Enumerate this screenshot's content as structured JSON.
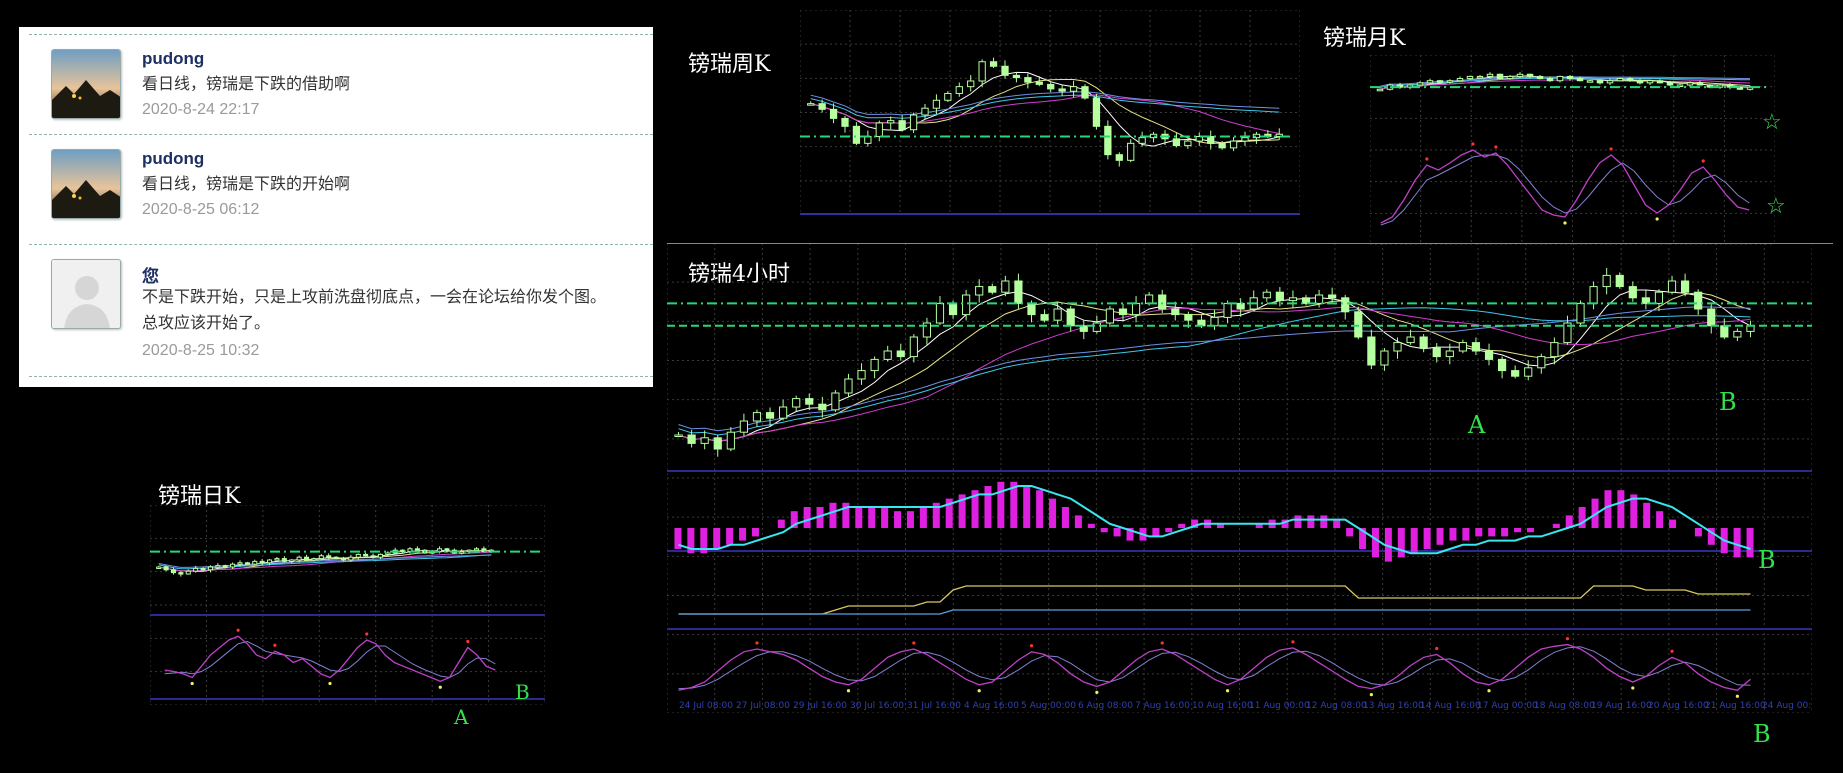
{
  "comments": [
    {
      "user": "pudong",
      "text": "看日线，镑瑞是下跌的借助啊",
      "time": "2020-8-24 22:17",
      "avatar": "landscape"
    },
    {
      "user": "pudong",
      "text": "看日线，镑瑞是下跌的开始啊",
      "time": "2020-8-25 06:12",
      "avatar": "landscape"
    },
    {
      "user": "您",
      "text": "不是下跌开始，只是上攻前洗盘彻底点，一会在论坛给你发个图。",
      "text2": "总攻应该开始了。",
      "time": "2020-8-25 10:32",
      "avatar": "default-user"
    }
  ],
  "colors": {
    "bull": "#b6ff9e",
    "bear": "#b6ff9e",
    "ma_fast": "#ffffff",
    "ma_yellow": "#e8e38a",
    "ma_magenta": "#d23bd2",
    "ma_cyan": "#3ec7e8",
    "ma_blue": "#6f8fe6",
    "level": "#25d97a",
    "macd_hist": "#e020e0",
    "macd_line": "#38e6f0",
    "stoch_k": "#c040c8",
    "stoch_d": "#8080d0",
    "marker": "#33e24a",
    "grid": "#3a3a3a"
  },
  "chart_data": [
    {
      "id": "weekly",
      "type": "candlestick",
      "title": "镑瑞周K",
      "close": [
        1.225,
        1.22,
        1.212,
        1.205,
        1.19,
        1.196,
        1.208,
        1.21,
        1.202,
        1.215,
        1.221,
        1.228,
        1.234,
        1.24,
        1.245,
        1.262,
        1.258,
        1.25,
        1.248,
        1.244,
        1.242,
        1.238,
        1.236,
        1.24,
        1.23,
        1.205,
        1.18,
        1.175,
        1.19,
        1.195,
        1.198,
        1.194,
        1.188,
        1.192,
        1.196,
        1.19,
        1.186,
        1.192,
        1.195,
        1.198,
        1.196,
        1.198
      ],
      "level": 1.196,
      "ylim": [
        1.14,
        1.29
      ]
    },
    {
      "id": "monthly",
      "type": "candlestick",
      "title": "镑瑞月K",
      "close": [
        1.28,
        1.29,
        1.285,
        1.29,
        1.295,
        1.3,
        1.298,
        1.3,
        1.305,
        1.31,
        1.31,
        1.315,
        1.305,
        1.31,
        1.315,
        1.31,
        1.305,
        1.3,
        1.31,
        1.305,
        1.3,
        1.3,
        1.295,
        1.3,
        1.305,
        1.3,
        1.295,
        1.3,
        1.295,
        1.29,
        1.29,
        1.295,
        1.29,
        1.285,
        1.29,
        1.285,
        1.28,
        1.285
      ],
      "level": 1.285,
      "ylim": [
        1.22,
        1.36
      ],
      "stoch": {
        "k": [
          12,
          18,
          35,
          55,
          70,
          65,
          72,
          80,
          85,
          78,
          82,
          70,
          55,
          40,
          25,
          20,
          18,
          35,
          55,
          72,
          80,
          70,
          50,
          30,
          22,
          30,
          45,
          62,
          68,
          55,
          40,
          28,
          25
        ],
        "d": [
          10,
          14,
          25,
          40,
          55,
          60,
          66,
          72,
          78,
          80,
          80,
          76,
          66,
          52,
          38,
          28,
          22,
          26,
          38,
          52,
          65,
          72,
          64,
          50,
          38,
          30,
          34,
          44,
          56,
          60,
          52,
          40,
          32
        ]
      }
    },
    {
      "id": "h4",
      "type": "candlestick",
      "title": "镑瑞4小时",
      "close": [
        1.175,
        1.172,
        1.174,
        1.17,
        1.176,
        1.18,
        1.183,
        1.181,
        1.185,
        1.188,
        1.186,
        1.184,
        1.19,
        1.195,
        1.198,
        1.202,
        1.205,
        1.203,
        1.21,
        1.215,
        1.222,
        1.218,
        1.225,
        1.228,
        1.226,
        1.23,
        1.222,
        1.218,
        1.216,
        1.22,
        1.214,
        1.212,
        1.215,
        1.22,
        1.218,
        1.222,
        1.225,
        1.22,
        1.218,
        1.216,
        1.214,
        1.217,
        1.222,
        1.22,
        1.224,
        1.226,
        1.223,
        1.224,
        1.222,
        1.225,
        1.224,
        1.219,
        1.21,
        1.2,
        1.205,
        1.208,
        1.21,
        1.206,
        1.203,
        1.205,
        1.208,
        1.205,
        1.202,
        1.198,
        1.196,
        1.199,
        1.203,
        1.208,
        1.215,
        1.222,
        1.228,
        1.232,
        1.228,
        1.224,
        1.222,
        1.226,
        1.23,
        1.226,
        1.22,
        1.214,
        1.21,
        1.212,
        1.214
      ],
      "level_a": 1.222,
      "level_b": 1.214,
      "ylim": [
        1.165,
        1.24
      ],
      "macd": {
        "hist": [
          -5,
          -6,
          -6,
          -5,
          -4,
          -3,
          -2,
          0,
          2,
          4,
          5,
          5,
          6,
          6,
          5,
          5,
          5,
          4,
          4,
          5,
          6,
          7,
          8,
          9,
          10,
          11,
          11,
          10,
          9,
          7,
          5,
          3,
          1,
          -1,
          -2,
          -3,
          -3,
          -2,
          -1,
          1,
          2,
          2,
          1,
          0,
          0,
          1,
          2,
          2,
          3,
          3,
          3,
          2,
          -2,
          -5,
          -7,
          -8,
          -7,
          -6,
          -5,
          -4,
          -3,
          -3,
          -2,
          -2,
          -2,
          -1,
          -1,
          0,
          1,
          3,
          5,
          7,
          9,
          9,
          8,
          6,
          4,
          2,
          0,
          -2,
          -4,
          -6,
          -7,
          -7
        ],
        "signal": [
          -4,
          -5,
          -5,
          -5,
          -4,
          -4,
          -3,
          -2,
          -1,
          1,
          2,
          3,
          4,
          5,
          5,
          5,
          5,
          5,
          5,
          5,
          5,
          6,
          7,
          8,
          8,
          9,
          10,
          10,
          9,
          8,
          7,
          5,
          3,
          1,
          0,
          -1,
          -2,
          -2,
          -1,
          0,
          1,
          1,
          1,
          1,
          1,
          1,
          1,
          2,
          2,
          2,
          2,
          2,
          0,
          -2,
          -4,
          -5,
          -6,
          -6,
          -6,
          -5,
          -4,
          -4,
          -3,
          -3,
          -3,
          -2,
          -2,
          -1,
          0,
          1,
          3,
          5,
          6,
          7,
          7,
          6,
          5,
          3,
          1,
          -1,
          -3,
          -4,
          -5
        ]
      },
      "osc": {
        "a": [
          -4,
          -4,
          -4,
          -4,
          -4,
          -4,
          -4,
          -4,
          -4,
          -4,
          -4,
          -4,
          -3,
          -2,
          -2,
          -2,
          -2,
          -2,
          -2,
          -1,
          -1,
          2,
          3,
          3,
          3,
          3,
          3,
          3,
          3,
          3,
          3,
          3,
          3,
          3,
          3,
          3,
          3,
          3,
          3,
          3,
          3,
          3,
          3,
          3,
          3,
          3,
          3,
          3,
          3,
          3,
          3,
          3,
          0,
          0,
          0,
          0,
          0,
          0,
          0,
          0,
          0,
          0,
          0,
          0,
          0,
          0,
          0,
          0,
          0,
          0,
          3,
          3,
          3,
          3,
          2,
          2,
          2,
          2,
          1,
          1,
          1,
          1,
          1
        ],
        "b": [
          -4,
          -4,
          -4,
          -4,
          -4,
          -4,
          -4,
          -4,
          -4,
          -4,
          -4,
          -4,
          -4,
          -4,
          -4,
          -4,
          -4,
          -4,
          -4,
          -4,
          -4,
          -3,
          -3,
          -3,
          -3,
          -3,
          -3,
          -3,
          -3,
          -3,
          -3,
          -3,
          -3,
          -3,
          -3,
          -3,
          -3,
          -3,
          -3,
          -3,
          -3,
          -3,
          -3,
          -3,
          -3,
          -3,
          -3,
          -3,
          -3,
          -3,
          -3,
          -3,
          -3,
          -3,
          -3,
          -3,
          -3,
          -3,
          -3,
          -3,
          -3,
          -3,
          -3,
          -3,
          -3,
          -3,
          -3,
          -3,
          -3,
          -3,
          -3,
          -3,
          -3,
          -3,
          -3,
          -3,
          -3,
          -3,
          -3,
          -3,
          -3,
          -3,
          -3
        ]
      },
      "stoch": {
        "k": [
          5,
          10,
          20,
          40,
          60,
          75,
          80,
          75,
          70,
          60,
          45,
          30,
          20,
          15,
          25,
          45,
          65,
          75,
          80,
          70,
          55,
          40,
          25,
          15,
          20,
          40,
          60,
          75,
          70,
          55,
          35,
          20,
          12,
          20,
          40,
          60,
          75,
          80,
          70,
          55,
          40,
          25,
          15,
          25,
          45,
          65,
          78,
          82,
          70,
          55,
          40,
          25,
          12,
          8,
          15,
          30,
          50,
          65,
          70,
          55,
          35,
          20,
          15,
          25,
          45,
          65,
          80,
          85,
          88,
          80,
          65,
          45,
          30,
          20,
          30,
          50,
          65,
          55,
          35,
          20,
          10,
          5,
          25
        ],
        "d": [
          8,
          9,
          14,
          25,
          40,
          55,
          68,
          75,
          75,
          68,
          58,
          45,
          33,
          24,
          22,
          30,
          45,
          60,
          72,
          74,
          68,
          56,
          42,
          30,
          24,
          28,
          42,
          58,
          68,
          66,
          54,
          38,
          24,
          20,
          28,
          44,
          60,
          72,
          74,
          66,
          54,
          40,
          28,
          24,
          32,
          48,
          63,
          74,
          76,
          68,
          55,
          40,
          27,
          17,
          14,
          20,
          33,
          48,
          60,
          62,
          54,
          40,
          28,
          22,
          28,
          42,
          60,
          74,
          82,
          84,
          76,
          62,
          46,
          34,
          30,
          38,
          50,
          56,
          50,
          38,
          26,
          15,
          14
        ]
      },
      "x_ticks": [
        "24 Jul 08:00",
        "27 Jul 08:00",
        "29 Jul 16:00",
        "30 Jul 16:00",
        "31 Jul 16:00",
        "4 Aug 16:00",
        "5 Aug 00:00",
        "6 Aug 08:00",
        "7 Aug 16:00",
        "10 Aug 16:00",
        "11 Aug 00:00",
        "12 Aug 08:00",
        "13 Aug 16:00",
        "14 Aug 16:00",
        "17 Aug 00:00",
        "18 Aug 08:00",
        "19 Aug 16:00",
        "20 Aug 16:00",
        "21 Aug 16:00",
        "24 Aug 00:00"
      ]
    },
    {
      "id": "daily",
      "type": "candlestick",
      "title": "镑瑞日K",
      "close": [
        1.2,
        1.198,
        1.196,
        1.195,
        1.197,
        1.199,
        1.198,
        1.2,
        1.201,
        1.2,
        1.202,
        1.203,
        1.202,
        1.204,
        1.203,
        1.205,
        1.206,
        1.204,
        1.205,
        1.207,
        1.205,
        1.206,
        1.208,
        1.207,
        1.206,
        1.205,
        1.207,
        1.209,
        1.208,
        1.207,
        1.209,
        1.21,
        1.212,
        1.211,
        1.213,
        1.212,
        1.21,
        1.211,
        1.213,
        1.212,
        1.21,
        1.211,
        1.212,
        1.213,
        1.211,
        1.212
      ],
      "level": 1.211,
      "ylim": [
        1.18,
        1.23
      ],
      "stoch": {
        "k": [
          40,
          38,
          35,
          30,
          45,
          60,
          70,
          80,
          85,
          75,
          60,
          55,
          65,
          60,
          50,
          55,
          45,
          35,
          30,
          40,
          55,
          70,
          80,
          75,
          60,
          50,
          45,
          40,
          35,
          30,
          25,
          30,
          50,
          70,
          60,
          45,
          40
        ],
        "d": [
          35,
          36,
          37,
          35,
          38,
          45,
          55,
          65,
          75,
          78,
          72,
          65,
          62,
          60,
          58,
          56,
          52,
          46,
          40,
          38,
          42,
          52,
          64,
          72,
          72,
          64,
          56,
          48,
          42,
          37,
          32,
          30,
          36,
          48,
          56,
          55,
          48
        ]
      }
    }
  ],
  "markers": {
    "monthly_star_1": "☆",
    "monthly_star_2": "☆",
    "h4_a": "A",
    "h4_b": "B",
    "macd_b": "B",
    "bottom_b": "B",
    "daily_a": "A",
    "daily_b": "B"
  }
}
